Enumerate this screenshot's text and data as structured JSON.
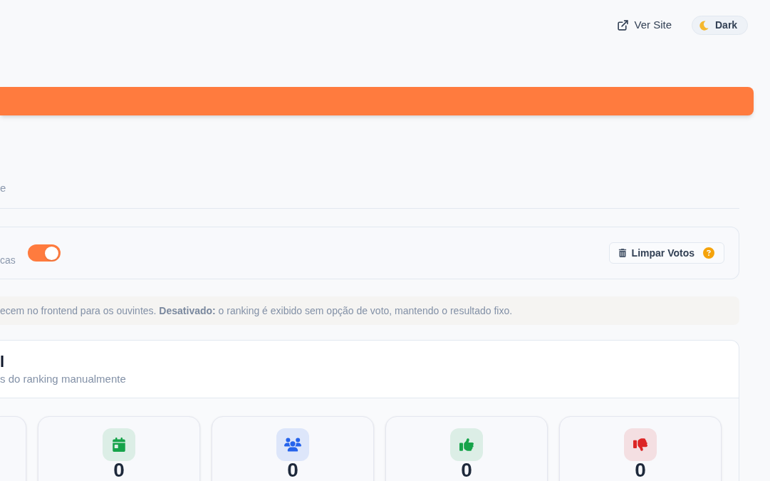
{
  "header": {
    "site_link": {
      "label": "Ver Site"
    },
    "theme_button": {
      "label": "Dark"
    }
  },
  "page": {
    "subtitle": "e"
  },
  "voting_card": {
    "toggle": {
      "label": "cas",
      "on": true
    },
    "clear_button": {
      "label": "Limpar Votos"
    }
  },
  "info_note": "ecem no frontend para os ouvintes. **Desativado:** o ranking é exibido sem opção de voto, mantendo o resultado fixo.",
  "ranking_panel": {
    "title": "l",
    "subtitle": "s do ranking manualmente",
    "stats": [
      {
        "kind": "calendar",
        "color": "#16a34a",
        "value": "0"
      },
      {
        "kind": "users",
        "color": "#2563eb",
        "value": "0"
      },
      {
        "kind": "thumbs-up",
        "color": "#16a34a",
        "value": "0"
      },
      {
        "kind": "thumbs-down",
        "color": "#dc2626",
        "value": "0"
      }
    ]
  }
}
